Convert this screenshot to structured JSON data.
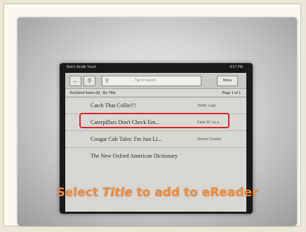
{
  "slide": {
    "caption": {
      "part1": "Select ",
      "emphasis": "Title",
      "part2": " to add to eReader"
    }
  },
  "device": {
    "status_left": "Bob's Kindle Touch",
    "status_right": "9:57 PM",
    "toolbar": {
      "back_icon": "back-arrow-icon",
      "store_icon": "cart-icon",
      "search_placeholder": "Tap to search",
      "menu_label": "Menu"
    },
    "list_header": {
      "left": "Archived Items (4) · By Title",
      "right": "Page 1 of 1"
    },
    "items": [
      {
        "title": "Catch That Collie!!!",
        "author": "Taskin Lugo"
      },
      {
        "title": "Caterpillars Don't Check Em...",
        "author": "Calar M. Lis a..."
      },
      {
        "title": "Cougar Cub Tales: I'm Just Li...",
        "author": "Sharon Cramer"
      },
      {
        "title": "The New Oxford American Dictionary",
        "author": ""
      }
    ]
  },
  "colors": {
    "caption": "#f08c3c",
    "highlight": "#d8242b"
  }
}
